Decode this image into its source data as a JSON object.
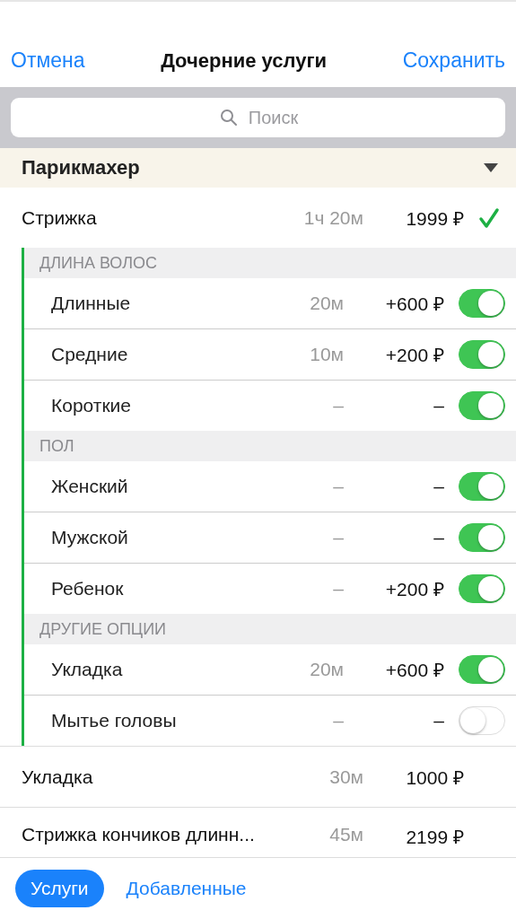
{
  "nav": {
    "cancel": "Отмена",
    "title": "Дочерние услуги",
    "save": "Сохранить"
  },
  "search": {
    "placeholder": "Поиск"
  },
  "category": {
    "title": "Парикмахер",
    "expanded": true
  },
  "services": [
    {
      "name": "Стрижка",
      "duration": "1ч 20м",
      "price": "1999 ₽",
      "checked": true,
      "groups": [
        {
          "title": "ДЛИНА ВОЛОС",
          "options": [
            {
              "name": "Длинные",
              "duration": "20м",
              "price": "+600 ₽",
              "on": true
            },
            {
              "name": "Средние",
              "duration": "10м",
              "price": "+200 ₽",
              "on": true
            },
            {
              "name": "Короткие",
              "duration": "–",
              "price": "–",
              "on": true
            }
          ]
        },
        {
          "title": "ПОЛ",
          "options": [
            {
              "name": "Женский",
              "duration": "–",
              "price": "–",
              "on": true
            },
            {
              "name": "Мужской",
              "duration": "–",
              "price": "–",
              "on": true
            },
            {
              "name": "Ребенок",
              "duration": "–",
              "price": "+200 ₽",
              "on": true
            }
          ]
        },
        {
          "title": "ДРУГИЕ ОПЦИИ",
          "options": [
            {
              "name": "Укладка",
              "duration": "20м",
              "price": "+600 ₽",
              "on": true
            },
            {
              "name": "Мытье головы",
              "duration": "–",
              "price": "–",
              "on": false
            }
          ]
        }
      ]
    },
    {
      "name": "Укладка",
      "duration": "30м",
      "price": "1000 ₽",
      "checked": false
    },
    {
      "name": "Стрижка кончиков длинн...",
      "duration": "45м",
      "price": "2199 ₽",
      "checked": false
    }
  ],
  "tabs": [
    {
      "label": "Услуги",
      "selected": true
    },
    {
      "label": "Добавленные",
      "selected": false
    }
  ]
}
